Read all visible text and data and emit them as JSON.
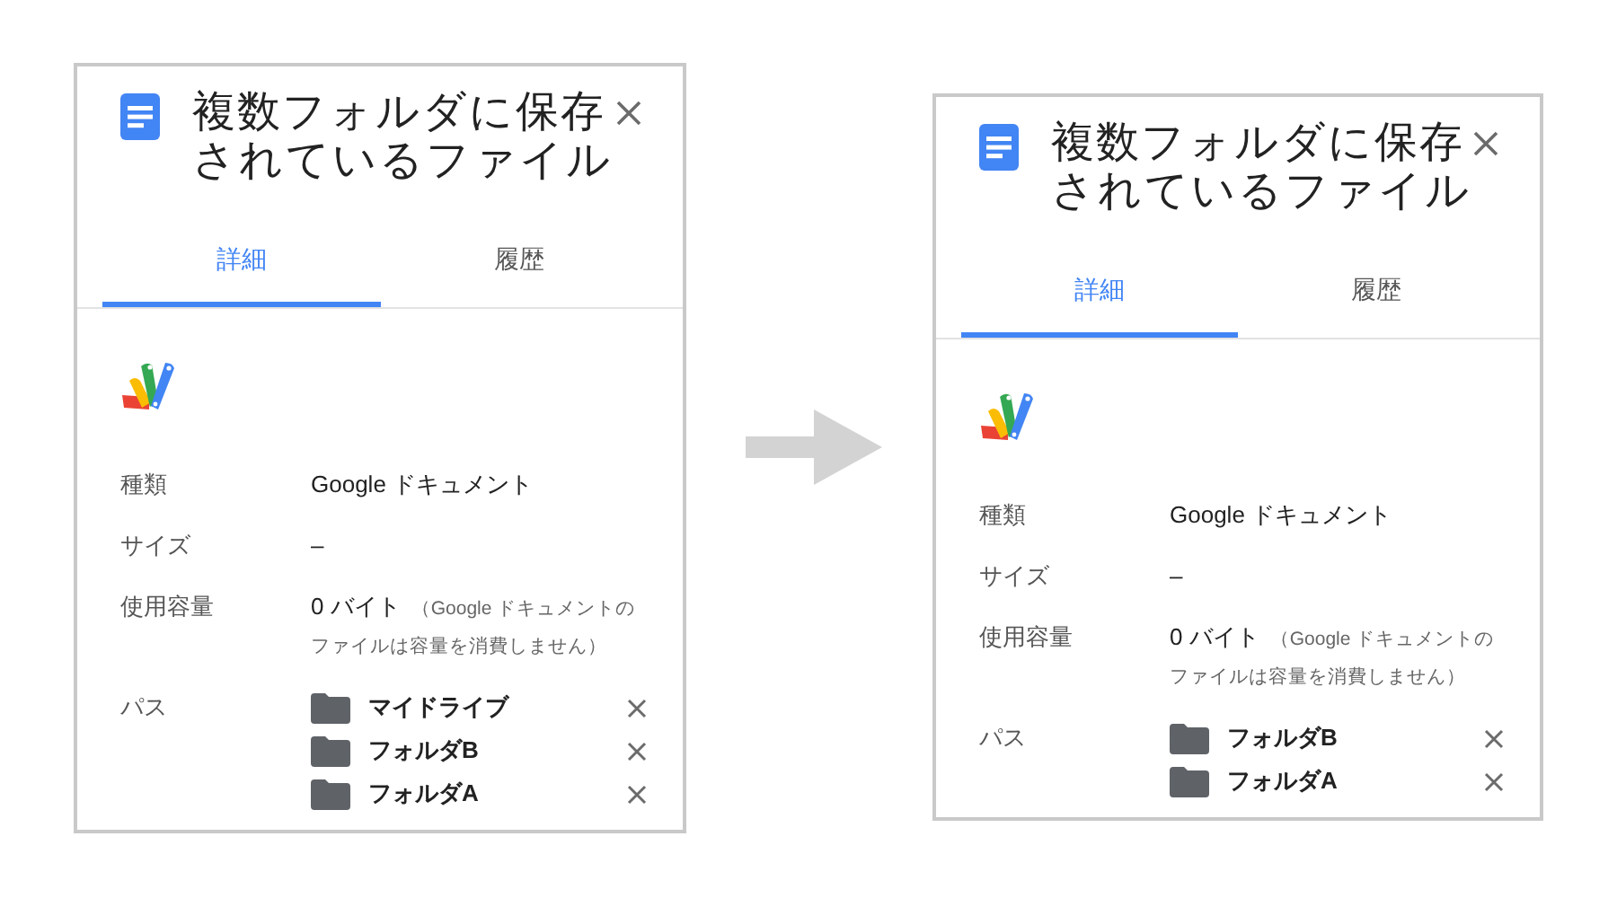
{
  "panels": [
    {
      "title": "複数フォルダに保存されているファイル",
      "tabs": [
        {
          "label": "詳細",
          "selected": true
        },
        {
          "label": "履歴",
          "selected": false
        }
      ],
      "details": [
        {
          "label": "種類",
          "value": "Google ドキュメント"
        },
        {
          "label": "サイズ",
          "value": "–"
        },
        {
          "label": "使用容量",
          "value": "0 バイト",
          "note": "（Google ドキュメントのファイルは容量を消費しません）"
        }
      ],
      "path_label": "パス",
      "paths": [
        {
          "name": "マイドライブ"
        },
        {
          "name": "フォルダB"
        },
        {
          "name": "フォルダA"
        }
      ]
    },
    {
      "title": "複数フォルダに保存されているファイル",
      "tabs": [
        {
          "label": "詳細",
          "selected": true
        },
        {
          "label": "履歴",
          "selected": false
        }
      ],
      "details": [
        {
          "label": "種類",
          "value": "Google ドキュメント"
        },
        {
          "label": "サイズ",
          "value": "–"
        },
        {
          "label": "使用容量",
          "value": "0 バイト",
          "note": "（Google ドキュメントのファイルは容量を消費しません）"
        }
      ],
      "path_label": "パス",
      "paths": [
        {
          "name": "フォルダB"
        },
        {
          "name": "フォルダA"
        }
      ]
    }
  ]
}
